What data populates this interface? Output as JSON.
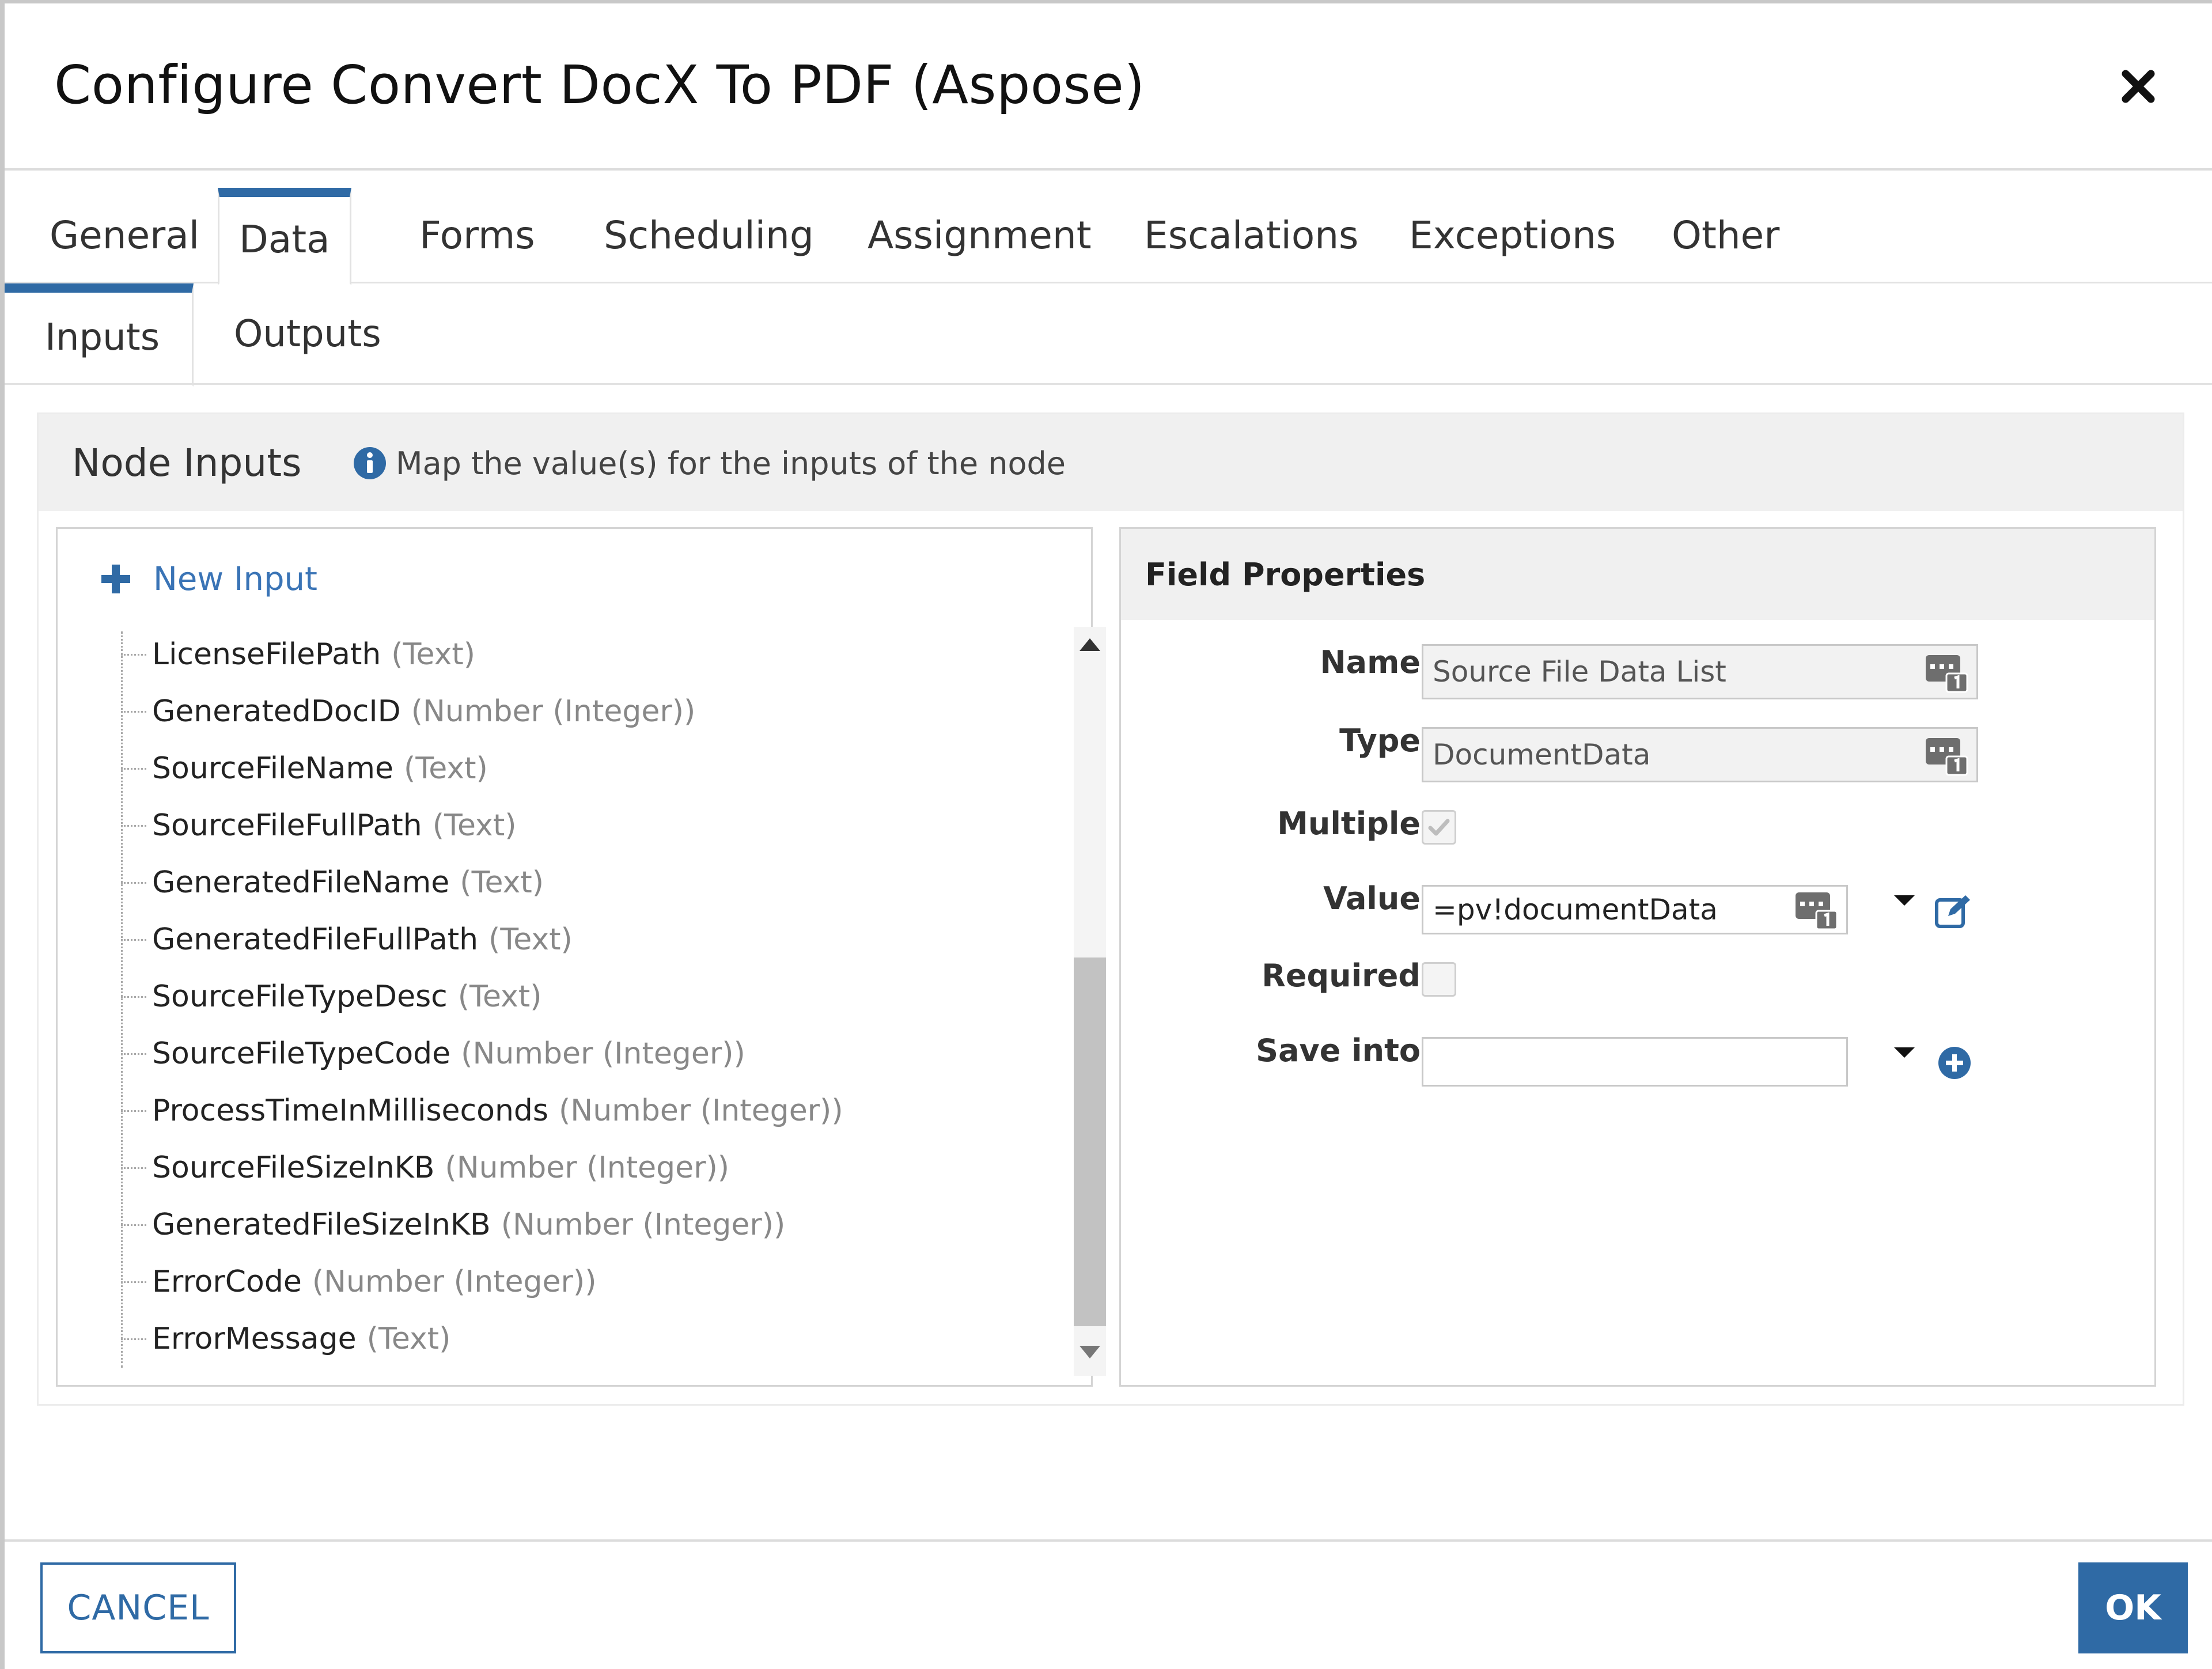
{
  "dialog": {
    "title": "Configure Convert DocX To PDF (Aspose)",
    "close_icon": "close-icon"
  },
  "main_tabs": [
    {
      "label": "General",
      "active": false
    },
    {
      "label": "Data",
      "active": true
    },
    {
      "label": "Forms",
      "active": false
    },
    {
      "label": "Scheduling",
      "active": false
    },
    {
      "label": "Assignment",
      "active": false
    },
    {
      "label": "Escalations",
      "active": false
    },
    {
      "label": "Exceptions",
      "active": false
    },
    {
      "label": "Other",
      "active": false
    }
  ],
  "sub_tabs": [
    {
      "label": "Inputs",
      "active": true
    },
    {
      "label": "Outputs",
      "active": false
    }
  ],
  "panel": {
    "title": "Node Inputs",
    "info_icon": "info-icon",
    "description": "Map the value(s) for the inputs of the node"
  },
  "inputs": {
    "new_input_label": "New Input",
    "new_input_icon": "plus-icon",
    "items": [
      {
        "name": "LicenseFilePath",
        "type": "(Text)"
      },
      {
        "name": "GeneratedDocID",
        "type": "(Number (Integer))"
      },
      {
        "name": "SourceFileName",
        "type": "(Text)"
      },
      {
        "name": "SourceFileFullPath",
        "type": "(Text)"
      },
      {
        "name": "GeneratedFileName",
        "type": "(Text)"
      },
      {
        "name": "GeneratedFileFullPath",
        "type": "(Text)"
      },
      {
        "name": "SourceFileTypeDesc",
        "type": "(Text)"
      },
      {
        "name": "SourceFileTypeCode",
        "type": "(Number (Integer))"
      },
      {
        "name": "ProcessTimeInMilliseconds",
        "type": "(Number (Integer))"
      },
      {
        "name": "SourceFileSizeInKB",
        "type": "(Number (Integer))"
      },
      {
        "name": "GeneratedFileSizeInKB",
        "type": "(Number (Integer))"
      },
      {
        "name": "ErrorCode",
        "type": "(Number (Integer))"
      },
      {
        "name": "ErrorMessage",
        "type": "(Text)"
      }
    ]
  },
  "field_properties": {
    "title": "Field Properties",
    "name_label": "Name",
    "name_value": "Source File Data List",
    "type_label": "Type",
    "type_value": "DocumentData",
    "multiple_label": "Multiple",
    "multiple_checked": true,
    "value_label": "Value",
    "value_value": "=pv!documentData",
    "required_label": "Required",
    "required_checked": false,
    "save_into_label": "Save into",
    "save_into_value": ""
  },
  "footer": {
    "cancel_label": "CANCEL",
    "ok_label": "OK"
  },
  "colors": {
    "accent": "#2f6aa5",
    "link": "#3a74b6"
  }
}
